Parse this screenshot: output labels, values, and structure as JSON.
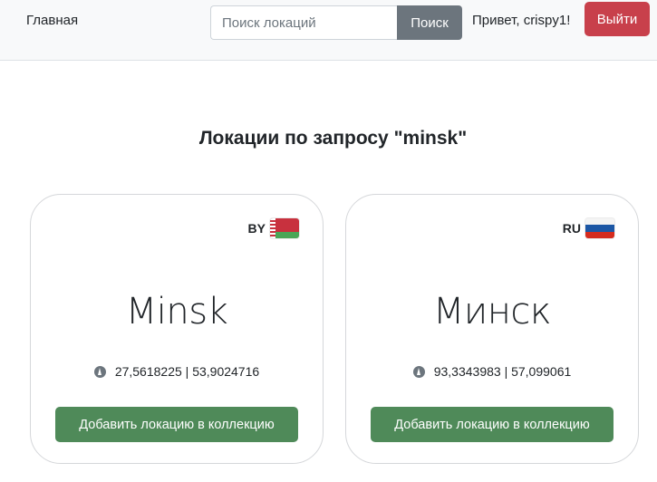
{
  "nav": {
    "home_label": "Главная",
    "search_placeholder": "Поиск локаций",
    "search_button": "Поиск",
    "greeting": "Привет, crispy1!",
    "logout_button": "Выйти"
  },
  "colors": {
    "logout": "#c8404b",
    "search_button": "#6c757d",
    "add_button": "#4f8a59"
  },
  "page_title": "Локации по запросу \"minsk\"",
  "locations": [
    {
      "country_code": "BY",
      "flag_icon": "belarus-flag-icon",
      "name": "Minsk",
      "coords": "27,5618225 | 53,9024716",
      "add_button": "Добавить локацию в коллекцию"
    },
    {
      "country_code": "RU",
      "flag_icon": "russia-flag-icon",
      "name": "Минск",
      "coords": "93,3343983 | 57,099061",
      "add_button": "Добавить локацию в коллекцию"
    }
  ]
}
